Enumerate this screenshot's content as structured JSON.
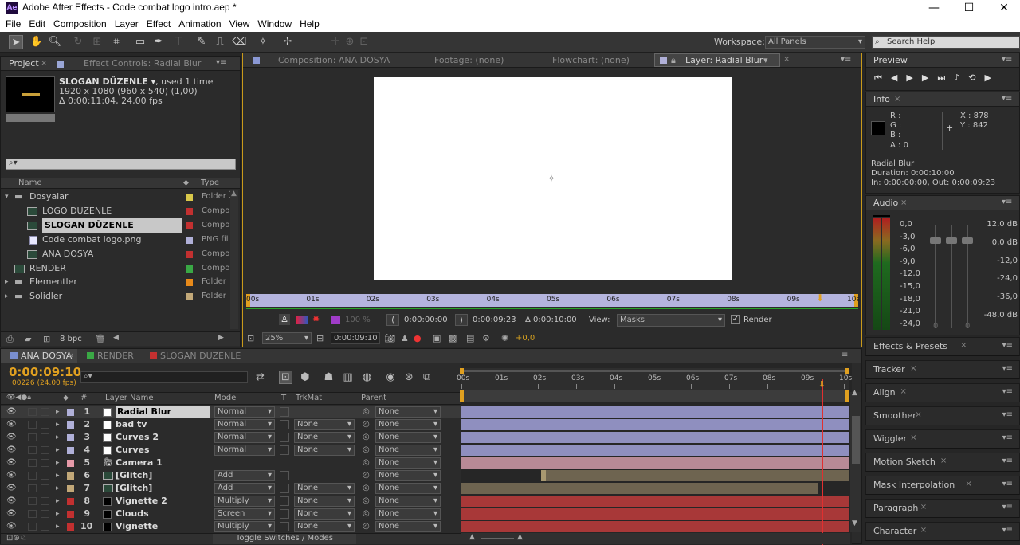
{
  "window": {
    "app_icon": "Ae",
    "title": "Adobe After Effects - Code combat logo intro.aep *",
    "minimize": "—",
    "maximize": "☐",
    "close": "✕"
  },
  "menubar": [
    "File",
    "Edit",
    "Composition",
    "Layer",
    "Effect",
    "Animation",
    "View",
    "Window",
    "Help"
  ],
  "toolbar": {
    "workspace_label": "Workspace:",
    "workspace_value": "All Panels",
    "search_placeholder": "Search Help"
  },
  "project": {
    "tab_project": "Project",
    "tab_effect_controls": "Effect Controls: Radial Blur",
    "selected_name": "SLOGAN DÜZENLE",
    "selected_used": ", used 1 time",
    "selected_dims": "1920 x 1080  (960 x 540) (1,00)",
    "selected_duration": "Δ 0:00:11:04, 24,00 fps",
    "search_placeholder": "",
    "col_name": "Name",
    "col_type": "Type",
    "items": [
      {
        "name": "Dosyalar",
        "type": "Folder",
        "color": "#d9c84a",
        "kind": "folder",
        "indent": 0,
        "expanded": true
      },
      {
        "name": "LOGO  DÜZENLE",
        "type": "Compo",
        "color": "#c23030",
        "kind": "comp",
        "indent": 1
      },
      {
        "name": "SLOGAN DÜZENLE",
        "type": "Compo",
        "color": "#c23030",
        "kind": "comp",
        "indent": 1,
        "selected": true
      },
      {
        "name": "Code combat logo.png",
        "type": "PNG fil",
        "color": "#b0b0d8",
        "kind": "file",
        "indent": 1
      },
      {
        "name": "ANA DOSYA",
        "type": "Compo",
        "color": "#c23030",
        "kind": "comp",
        "indent": 1
      },
      {
        "name": "RENDER",
        "type": "Compo",
        "color": "#3aa845",
        "kind": "comp",
        "indent": 0
      },
      {
        "name": "Elementler",
        "type": "Folder",
        "color": "#e88a1a",
        "kind": "folder",
        "indent": 0
      },
      {
        "name": "Solidler",
        "type": "Folder",
        "color": "#c2a878",
        "kind": "folder",
        "indent": 0
      }
    ],
    "bpc": "8 bpc"
  },
  "viewer": {
    "tab_composition": "Composition: ANA DOSYA",
    "tab_footage": "Footage: (none)",
    "tab_flowchart": "Flowchart: (none)",
    "tab_layer": "Layer: Radial Blur",
    "ruler": [
      "00s",
      "01s",
      "02s",
      "03s",
      "04s",
      "05s",
      "06s",
      "07s",
      "08s",
      "09s",
      "10s"
    ],
    "opacity": "100 %",
    "in_time": "0:00:00:00",
    "out_time": "0:00:09:23",
    "duration": "Δ 0:00:10:00",
    "view_label": "View:",
    "view_value": "Masks",
    "render_label": "Render",
    "zoom": "25%",
    "current_time": "0:00:09:10",
    "exposure": "+0,0"
  },
  "preview": {
    "tab": "Preview"
  },
  "info": {
    "tab": "Info",
    "r": "R :",
    "g": "G :",
    "b": "B :",
    "a": "A : 0",
    "x": "X : 878",
    "y": "Y : 842",
    "layer_name": "Radial Blur",
    "duration": "Duration: 0:00:10:00",
    "inout": "In: 0:00:00:00, Out: 0:00:09:23"
  },
  "audio": {
    "tab": "Audio",
    "left_scale": [
      "0,0",
      "-3,0",
      "-6,0",
      "-9,0",
      "-12,0",
      "-15,0",
      "-18,0",
      "-21,0",
      "-24,0"
    ],
    "right_db": [
      "12,0 dB",
      "0,0 dB",
      "-12,0",
      "-24,0",
      "-36,0",
      "-48,0 dB"
    ],
    "slider_zero_l": "0",
    "slider_zero_r": "0"
  },
  "side_panels": [
    "Effects & Presets",
    "Tracker",
    "Align",
    "Smoother",
    "Wiggler",
    "Motion Sketch",
    "Mask Interpolation",
    "Paragraph",
    "Character"
  ],
  "timeline": {
    "tabs": [
      "ANA DOSYA",
      "RENDER",
      "SLOGAN DÜZENLE"
    ],
    "tab_colors": [
      "#7a8fd0",
      "#3aa845",
      "#c23030"
    ],
    "timecode": "0:00:09:10",
    "frames": "00226 (24.00 fps)",
    "search_placeholder": "",
    "col_layer_name": "Layer Name",
    "col_mode": "Mode",
    "col_t": "T",
    "col_trkmat": "TrkMat",
    "col_parent": "Parent",
    "col_hash": "#",
    "ruler": [
      "00s",
      "01s",
      "02s",
      "03s",
      "04s",
      "05s",
      "06s",
      "07s",
      "08s",
      "09s",
      "10s"
    ],
    "playhead_fraction": 0.937,
    "toggle_label": "Toggle Switches / Modes",
    "layers": [
      {
        "num": "1",
        "name": "Radial Blur",
        "label": "#b0b0d8",
        "mode": "Normal",
        "trkmat": "",
        "parent": "None",
        "icon": "solid-white",
        "bar": "#8f8fbf",
        "start": 0,
        "end": 1,
        "selected": true
      },
      {
        "num": "2",
        "name": "bad tv",
        "label": "#b0b0d8",
        "mode": "Normal",
        "trkmat": "None",
        "parent": "None",
        "icon": "solid-white",
        "bar": "#8f8fbf",
        "start": 0,
        "end": 1
      },
      {
        "num": "3",
        "name": "Curves 2",
        "label": "#b0b0d8",
        "mode": "Normal",
        "trkmat": "None",
        "parent": "None",
        "icon": "solid-white",
        "bar": "#8f8fbf",
        "start": 0,
        "end": 1
      },
      {
        "num": "4",
        "name": "Curves",
        "label": "#b0b0d8",
        "mode": "Normal",
        "trkmat": "None",
        "parent": "None",
        "icon": "solid-white",
        "bar": "#8f8fbf",
        "start": 0,
        "end": 1
      },
      {
        "num": "5",
        "name": "Camera 1",
        "label": "#e69aa8",
        "mode": "",
        "trkmat": "",
        "parent": "None",
        "icon": "camera",
        "bar": "#b88a96",
        "start": 0,
        "end": 1
      },
      {
        "num": "6",
        "name": "[Glitch]",
        "label": "#c2a878",
        "mode": "Add",
        "trkmat": "",
        "parent": "None",
        "icon": "comp",
        "bar": "#6e6450",
        "start": 0.205,
        "end": 1
      },
      {
        "num": "7",
        "name": "[Glitch]",
        "label": "#c2a878",
        "mode": "Add",
        "trkmat": "None",
        "parent": "None",
        "icon": "comp",
        "bar": "#6e6450",
        "start": 0,
        "end": 0.92
      },
      {
        "num": "8",
        "name": "Vignette 2",
        "label": "#c23030",
        "mode": "Multiply",
        "trkmat": "None",
        "parent": "None",
        "icon": "solid-black",
        "bar": "#a83838",
        "start": 0,
        "end": 1
      },
      {
        "num": "9",
        "name": "Clouds",
        "label": "#c23030",
        "mode": "Screen",
        "trkmat": "None",
        "parent": "None",
        "icon": "solid-black",
        "bar": "#a83838",
        "start": 0,
        "end": 1
      },
      {
        "num": "10",
        "name": "Vignette",
        "label": "#c23030",
        "mode": "Multiply",
        "trkmat": "None",
        "parent": "None",
        "icon": "solid-black",
        "bar": "#a83838",
        "start": 0,
        "end": 1
      }
    ]
  },
  "colors": {
    "accent_gold": "#e0a020",
    "playhead": "#e03030",
    "work_area": "#2aa52a"
  }
}
